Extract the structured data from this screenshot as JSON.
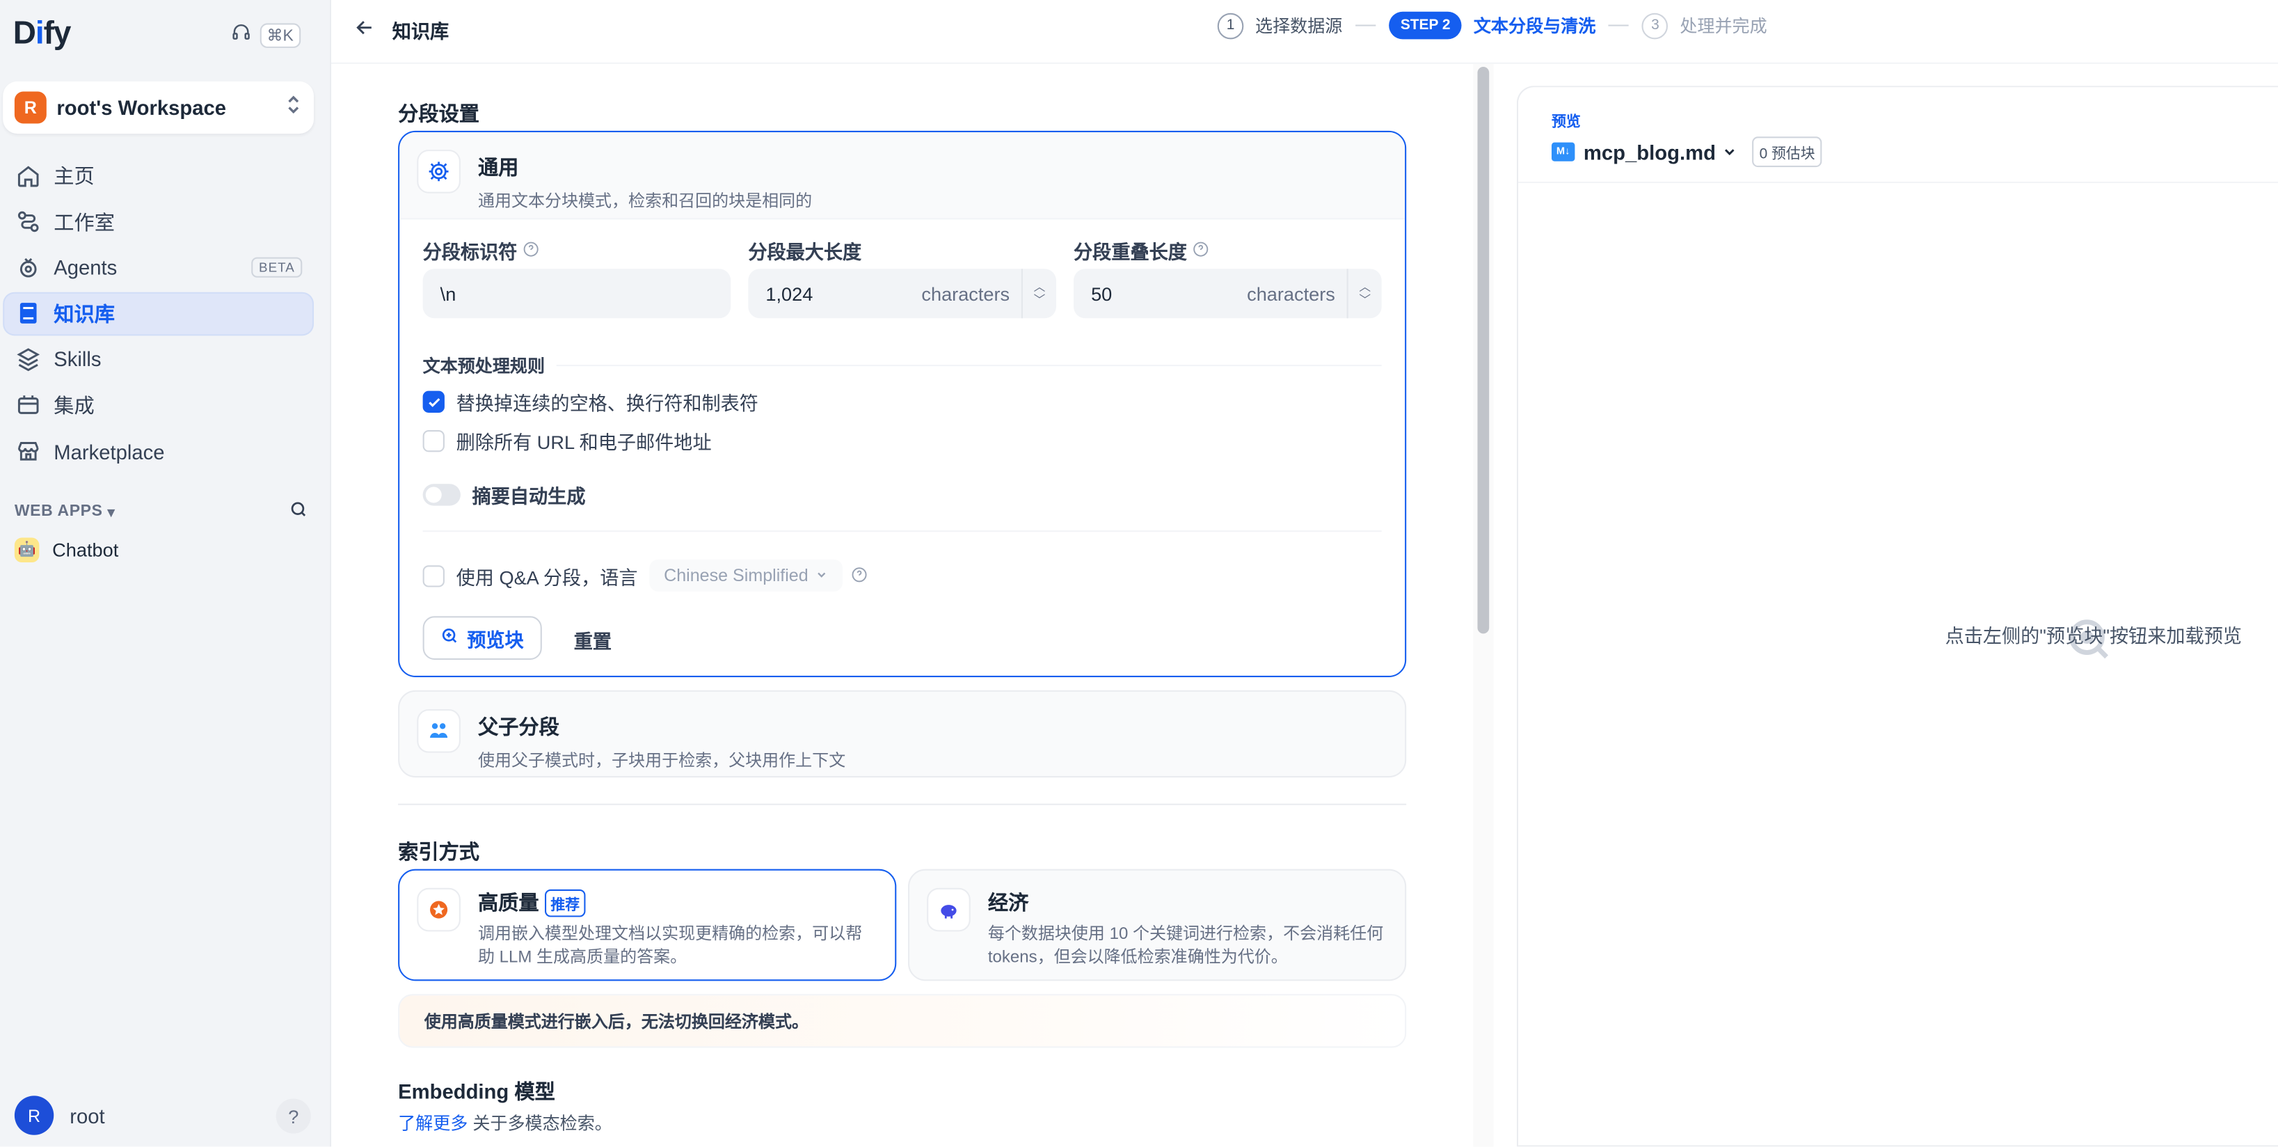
{
  "sidebar": {
    "logo": {
      "pre": "D",
      "accent": "i",
      "post": "fy"
    },
    "shortcut": "⌘K",
    "workspace": {
      "initial": "R",
      "name": "root's Workspace"
    },
    "nav": [
      {
        "label": "主页",
        "icon": "home-icon"
      },
      {
        "label": "工作室",
        "icon": "studio-icon"
      },
      {
        "label": "Agents",
        "icon": "agent-icon",
        "badge": "BETA"
      },
      {
        "label": "知识库",
        "icon": "knowledge-icon",
        "active": true
      },
      {
        "label": "Skills",
        "icon": "layers-icon"
      },
      {
        "label": "集成",
        "icon": "integration-icon"
      },
      {
        "label": "Marketplace",
        "icon": "store-icon"
      }
    ],
    "web_apps_label": "WEB APPS",
    "chatbot": "Chatbot",
    "user": {
      "initial": "R",
      "name": "root"
    },
    "help": "?"
  },
  "header": {
    "title": "知识库",
    "steps": [
      {
        "num": "1",
        "label": "选择数据源"
      },
      {
        "num": "STEP 2",
        "label": "文本分段与清洗"
      },
      {
        "num": "3",
        "label": "处理并完成"
      }
    ]
  },
  "segmentation": {
    "section_title": "分段设置",
    "general": {
      "title": "通用",
      "desc": "通用文本分块模式，检索和召回的块是相同的",
      "fields": {
        "delimiter_label": "分段标识符",
        "delimiter_value": "\\n",
        "max_len_label": "分段最大长度",
        "max_len_value": "1,024",
        "overlap_label": "分段重叠长度",
        "overlap_value": "50",
        "unit": "characters"
      },
      "preprocess_title": "文本预处理规则",
      "rule1": "替换掉连续的空格、换行符和制表符",
      "rule1_checked": true,
      "rule2": "删除所有 URL 和电子邮件地址",
      "rule2_checked": false,
      "auto_summary": "摘要自动生成",
      "qa_label": "使用 Q&A 分段，语言",
      "qa_language": "Chinese Simplified",
      "preview_btn": "预览块",
      "reset_btn": "重置"
    },
    "parent_child": {
      "title": "父子分段",
      "desc": "使用父子模式时，子块用于检索，父块用作上下文"
    }
  },
  "index": {
    "section_title": "索引方式",
    "high_quality": {
      "title": "高质量",
      "badge": "推荐",
      "desc": "调用嵌入模型处理文档以实现更精确的检索，可以帮助 LLM 生成高质量的答案。"
    },
    "economy": {
      "title": "经济",
      "desc": "每个数据块使用 10 个关键词进行检索，不会消耗任何 tokens，但会以降低检索准确性为代价。"
    },
    "warning": "使用高质量模式进行嵌入后，无法切换回经济模式。"
  },
  "embedding": {
    "title": "Embedding 模型",
    "learn_more": "了解更多",
    "learn_more_suffix": "关于多模态检索。"
  },
  "preview": {
    "label": "预览",
    "file": "mcp_blog.md",
    "count": "0 预估块",
    "empty": "点击左侧的\"预览块\"按钮来加载预览"
  },
  "colors": {
    "accent": "#155eef",
    "workspace_avatar": "#ef6820",
    "user_avatar": "#1d4ed8"
  }
}
